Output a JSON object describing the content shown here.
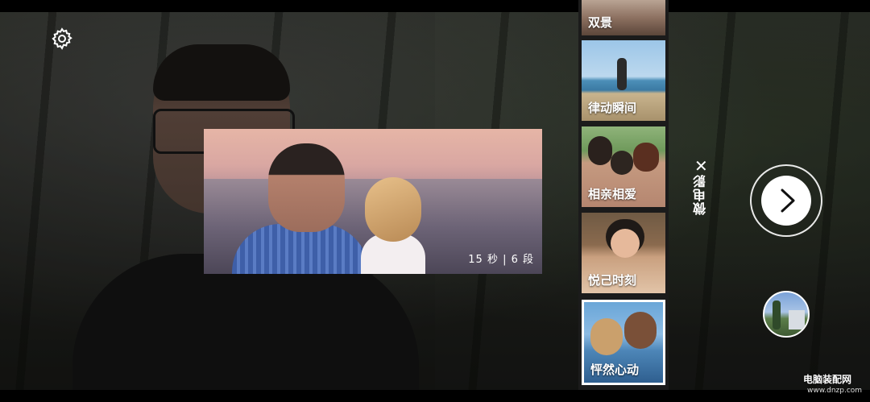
{
  "preview": {
    "duration_label": "15 秒 | 6 段"
  },
  "mode": {
    "title": "微电影",
    "close_symbol": "✕"
  },
  "templates": [
    {
      "label": "双景",
      "selected": false
    },
    {
      "label": "律动瞬间",
      "selected": false
    },
    {
      "label": "相亲相爱",
      "selected": false
    },
    {
      "label": "悦己时刻",
      "selected": false
    },
    {
      "label": "怦然心动",
      "selected": true
    }
  ],
  "watermark": {
    "title": "电脑装配网",
    "url": "www.dnzp.com"
  },
  "colors": {
    "accent": "#ffffff",
    "strip_bg": "#1b1b1b"
  },
  "icons": {
    "settings": "gear-icon",
    "next": "chevron-right-icon",
    "close": "close-icon"
  }
}
